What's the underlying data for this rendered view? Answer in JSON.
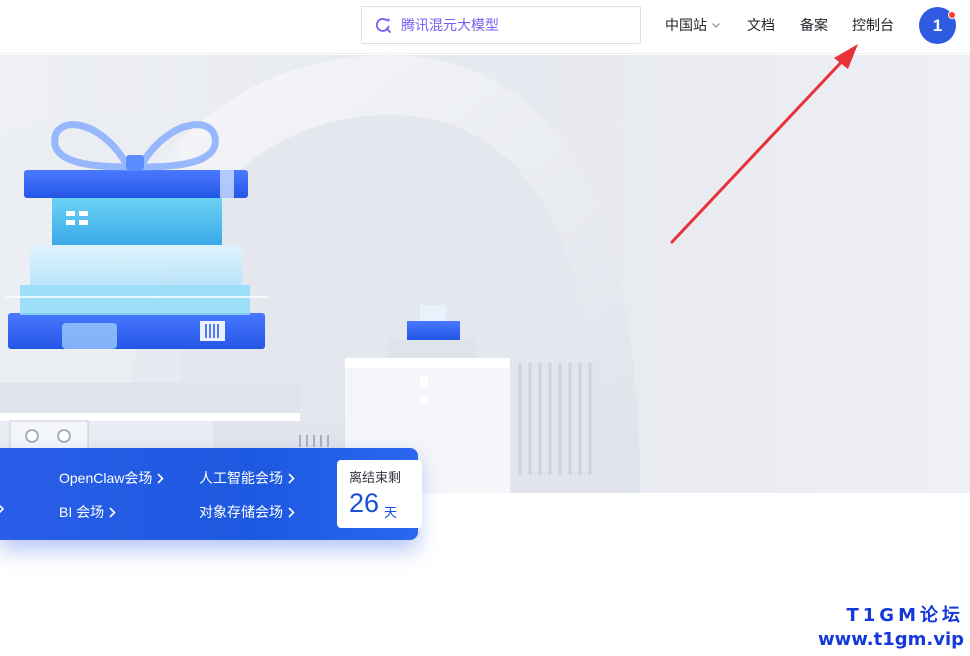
{
  "header": {
    "search_placeholder": "腾讯混元大模型",
    "region": "中国站",
    "docs": "文档",
    "beian": "备案",
    "console": "控制台",
    "avatar_initial": "1",
    "icons": {
      "search": "sparkle-search-icon",
      "region_toggle": "chevron-down-icon"
    }
  },
  "promo": {
    "venues": [
      "OpenClaw会场",
      "人工智能会场",
      "BI 会场",
      "对象存储会场"
    ],
    "countdown": {
      "label": "离结束剩",
      "days": "26",
      "unit": "天"
    },
    "colors": {
      "strip": "#1d59e0",
      "text": "#ffffff",
      "countdown_number": "#1a4fd8"
    }
  },
  "watermark": {
    "line1": "T1GM论坛",
    "line2": "www.t1gm.vip"
  },
  "colors": {
    "accent": "#2f5be0",
    "annotation_arrow": "#e8323a",
    "search_accent": "#7a5cf0"
  }
}
